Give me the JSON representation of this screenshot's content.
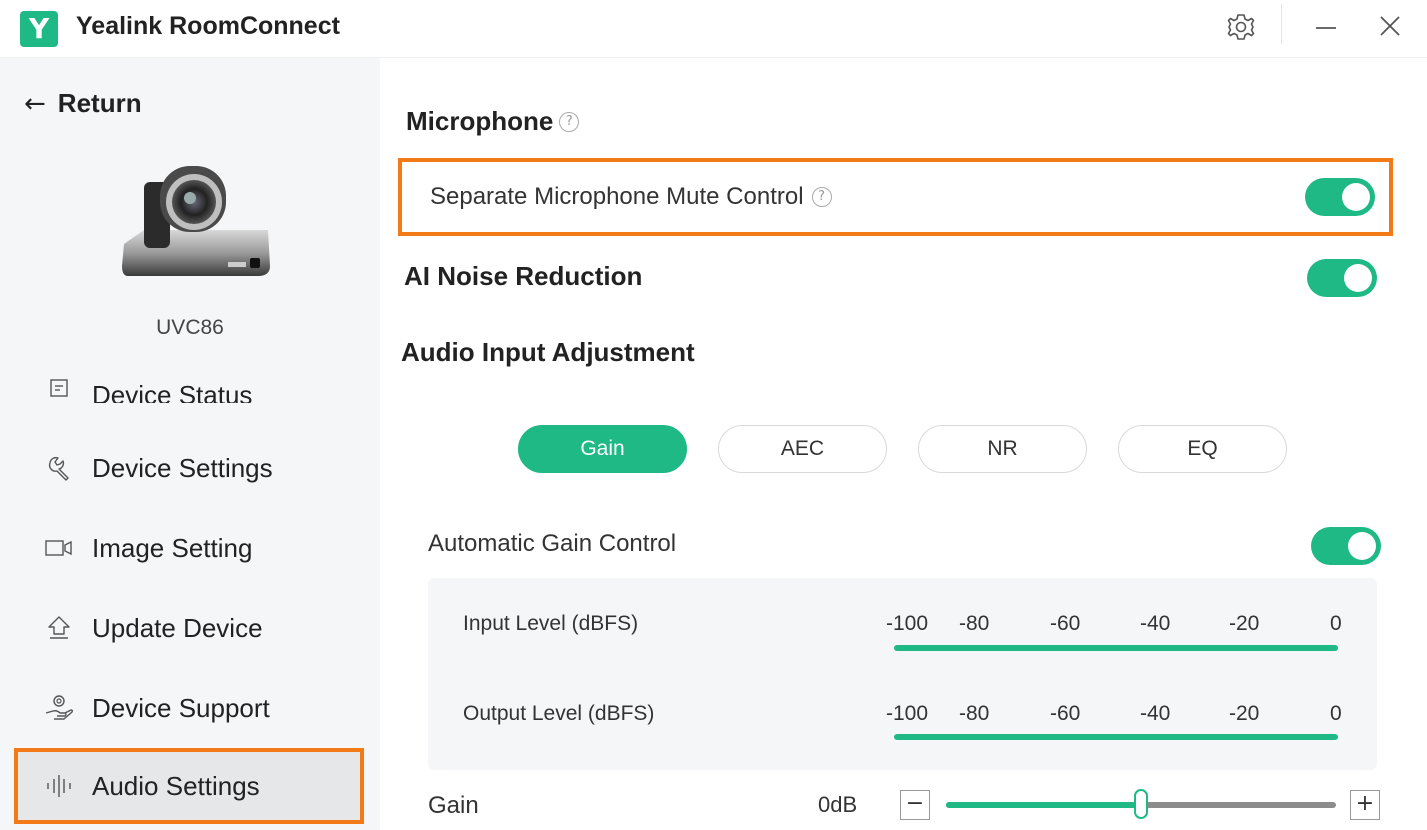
{
  "app": {
    "logo_letter": "Y",
    "title": "Yealink RoomConnect",
    "accent": "#1fb985",
    "highlight": "#f27b17"
  },
  "titlebar": {
    "icons": [
      "gear-icon",
      "minimize-icon",
      "close-icon"
    ]
  },
  "sidebar": {
    "return_label": "Return",
    "device_name": "UVC86",
    "items": [
      {
        "label": "Device Status",
        "icon": "status-icon"
      },
      {
        "label": "Device Settings",
        "icon": "wrench-icon"
      },
      {
        "label": "Image Setting",
        "icon": "camera-icon"
      },
      {
        "label": "Update Device",
        "icon": "upload-icon"
      },
      {
        "label": "Device Support",
        "icon": "support-icon"
      },
      {
        "label": "Audio Settings",
        "icon": "audio-bars-icon",
        "active": true
      }
    ]
  },
  "main": {
    "microphone_title": "Microphone",
    "separate_mute_label": "Separate Microphone Mute Control",
    "separate_mute_on": true,
    "ai_noise_label": "AI Noise Reduction",
    "ai_noise_on": true,
    "audio_input_title": "Audio Input Adjustment",
    "tabs": [
      {
        "label": "Gain",
        "active": true
      },
      {
        "label": "AEC"
      },
      {
        "label": "NR"
      },
      {
        "label": "EQ"
      }
    ],
    "agc_label": "Automatic Gain Control",
    "agc_on": true,
    "input_level_label": "Input Level (dBFS)",
    "output_level_label": "Output Level (dBFS)",
    "scale_ticks": [
      "-100",
      "-80",
      "-60",
      "-40",
      "-20",
      "0"
    ],
    "gain_label": "Gain",
    "gain_value": "0dB",
    "gain_minus": "−",
    "gain_plus": "+",
    "gain_slider_fraction": 0.5
  }
}
